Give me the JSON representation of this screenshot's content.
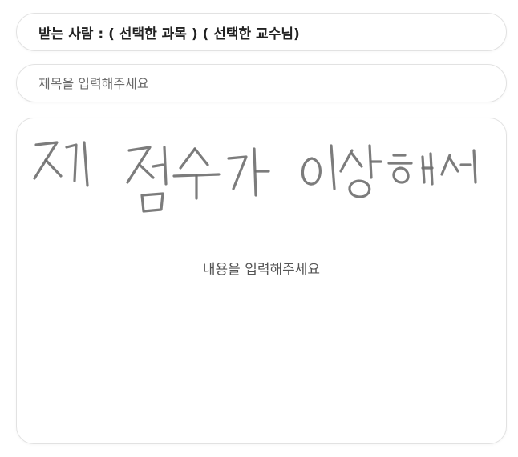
{
  "recipient": {
    "text": "받는 사람 : ( 선택한 과목 ) ( 선택한 교수님)"
  },
  "subject": {
    "placeholder": "제목을 입력해주세요",
    "value": ""
  },
  "content": {
    "placeholder": "내용을 입력해주세요",
    "value": "",
    "handwriting_text": "제 점수가 이상해서",
    "ink_color": "#6e6e6e"
  }
}
